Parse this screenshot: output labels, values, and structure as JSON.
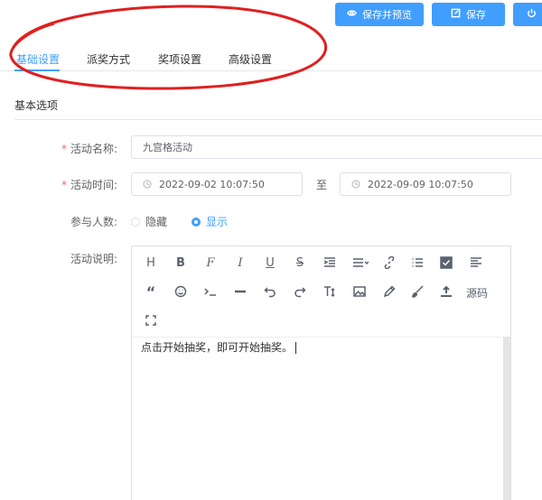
{
  "header": {
    "preview_button": "保存并预览",
    "save_button": "保存"
  },
  "tabs": [
    "基础设置",
    "派奖方式",
    "奖项设置",
    "高级设置"
  ],
  "section": {
    "title": "基本选项"
  },
  "form": {
    "name_label": "活动名称:",
    "name_value": "九宫格活动",
    "time_label": "活动时间:",
    "start_time": "2022-09-02 10:07:50",
    "separator": "至",
    "end_time": "2022-09-09 10:07:50",
    "participants_label": "参与人数:",
    "participants_options": [
      "隐藏",
      "显示"
    ],
    "participants_selected": "显示",
    "description_label": "活动说明:"
  },
  "editor": {
    "toolbar_icons": [
      "heading-icon",
      "bold-icon",
      "font-icon",
      "italic-icon",
      "underline-icon",
      "strikethrough-icon",
      "indent-icon",
      "align-icon",
      "link-icon",
      "list-icon",
      "checkbox-icon",
      "paragraph-icon",
      "quote-icon",
      "emoji-icon",
      "code-icon",
      "hr-icon",
      "undo-icon",
      "redo-icon",
      "text-size-icon",
      "image-icon",
      "pen-icon",
      "brush-icon",
      "upload-icon",
      "fullscreen-icon"
    ],
    "source_label": "源码",
    "content": "点击开始抽奖，即可开始抽奖。"
  },
  "colors": {
    "primary": "#409eff",
    "required": "#f56c6c",
    "annotation": "#e02020"
  }
}
